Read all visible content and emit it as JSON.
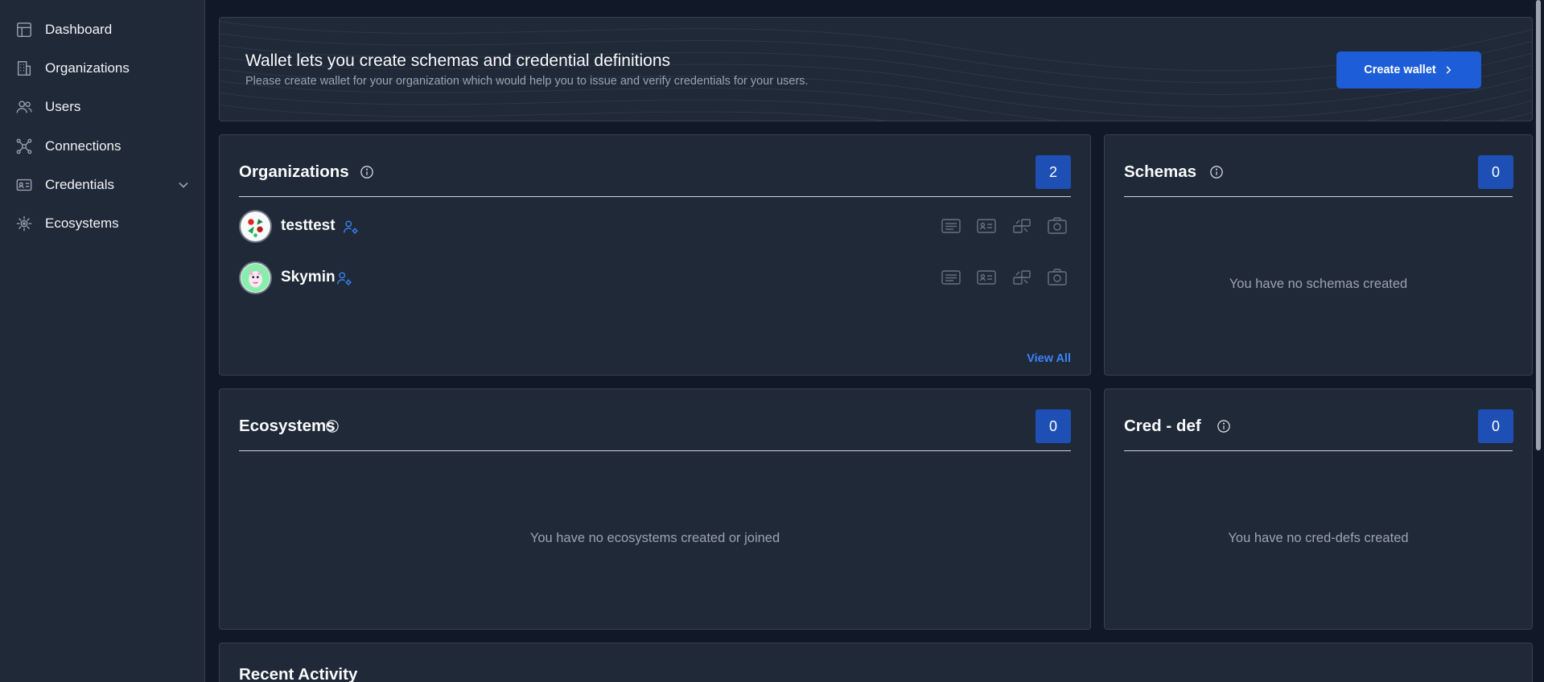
{
  "sidebar": {
    "items": [
      {
        "label": "Dashboard",
        "icon": "dashboard-icon"
      },
      {
        "label": "Organizations",
        "icon": "building-icon"
      },
      {
        "label": "Users",
        "icon": "users-icon"
      },
      {
        "label": "Connections",
        "icon": "connections-icon"
      },
      {
        "label": "Credentials",
        "icon": "id-card-icon"
      },
      {
        "label": "Ecosystems",
        "icon": "ecosystem-icon"
      }
    ]
  },
  "banner": {
    "title": "Wallet lets you create schemas and credential definitions",
    "subtitle": "Please create wallet for your organization which would help you to issue and verify credentials for your users.",
    "button_label": "Create wallet"
  },
  "organizations": {
    "title": "Organizations",
    "count": "2",
    "items": [
      {
        "name": "testtest"
      },
      {
        "name": "Skymin"
      }
    ],
    "view_all": "View All"
  },
  "schemas": {
    "title": "Schemas",
    "count": "0",
    "empty": "You have no schemas created"
  },
  "ecosystems": {
    "title": "Ecosystems",
    "count": "0",
    "empty": "You have no ecosystems created or joined"
  },
  "creddefs": {
    "title": "Cred - def",
    "count": "0",
    "empty": "You have no cred-defs created"
  },
  "recent": {
    "title": "Recent Activity"
  },
  "colors": {
    "accent": "#1d5ed8",
    "count_badge": "#1e4fb5",
    "background": "#111827",
    "card": "#1f2937"
  }
}
